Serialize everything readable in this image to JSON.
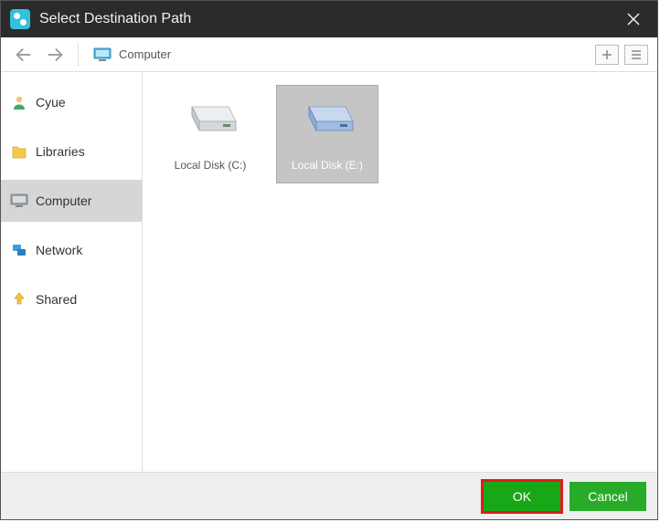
{
  "window": {
    "title": "Select Destination Path"
  },
  "toolbar": {
    "path_label": "Computer"
  },
  "sidebar": {
    "items": [
      {
        "label": "Cyue",
        "icon": "user"
      },
      {
        "label": "Libraries",
        "icon": "libraries"
      },
      {
        "label": "Computer",
        "icon": "computer",
        "active": true
      },
      {
        "label": "Network",
        "icon": "network"
      },
      {
        "label": "Shared",
        "icon": "shared"
      }
    ]
  },
  "drives": [
    {
      "label": "Local Disk (C:)",
      "selected": false,
      "color": "#6b8a6b"
    },
    {
      "label": "Local Disk (E:)",
      "selected": true,
      "color": "#6a91c8"
    }
  ],
  "footer": {
    "ok_label": "OK",
    "cancel_label": "Cancel"
  }
}
